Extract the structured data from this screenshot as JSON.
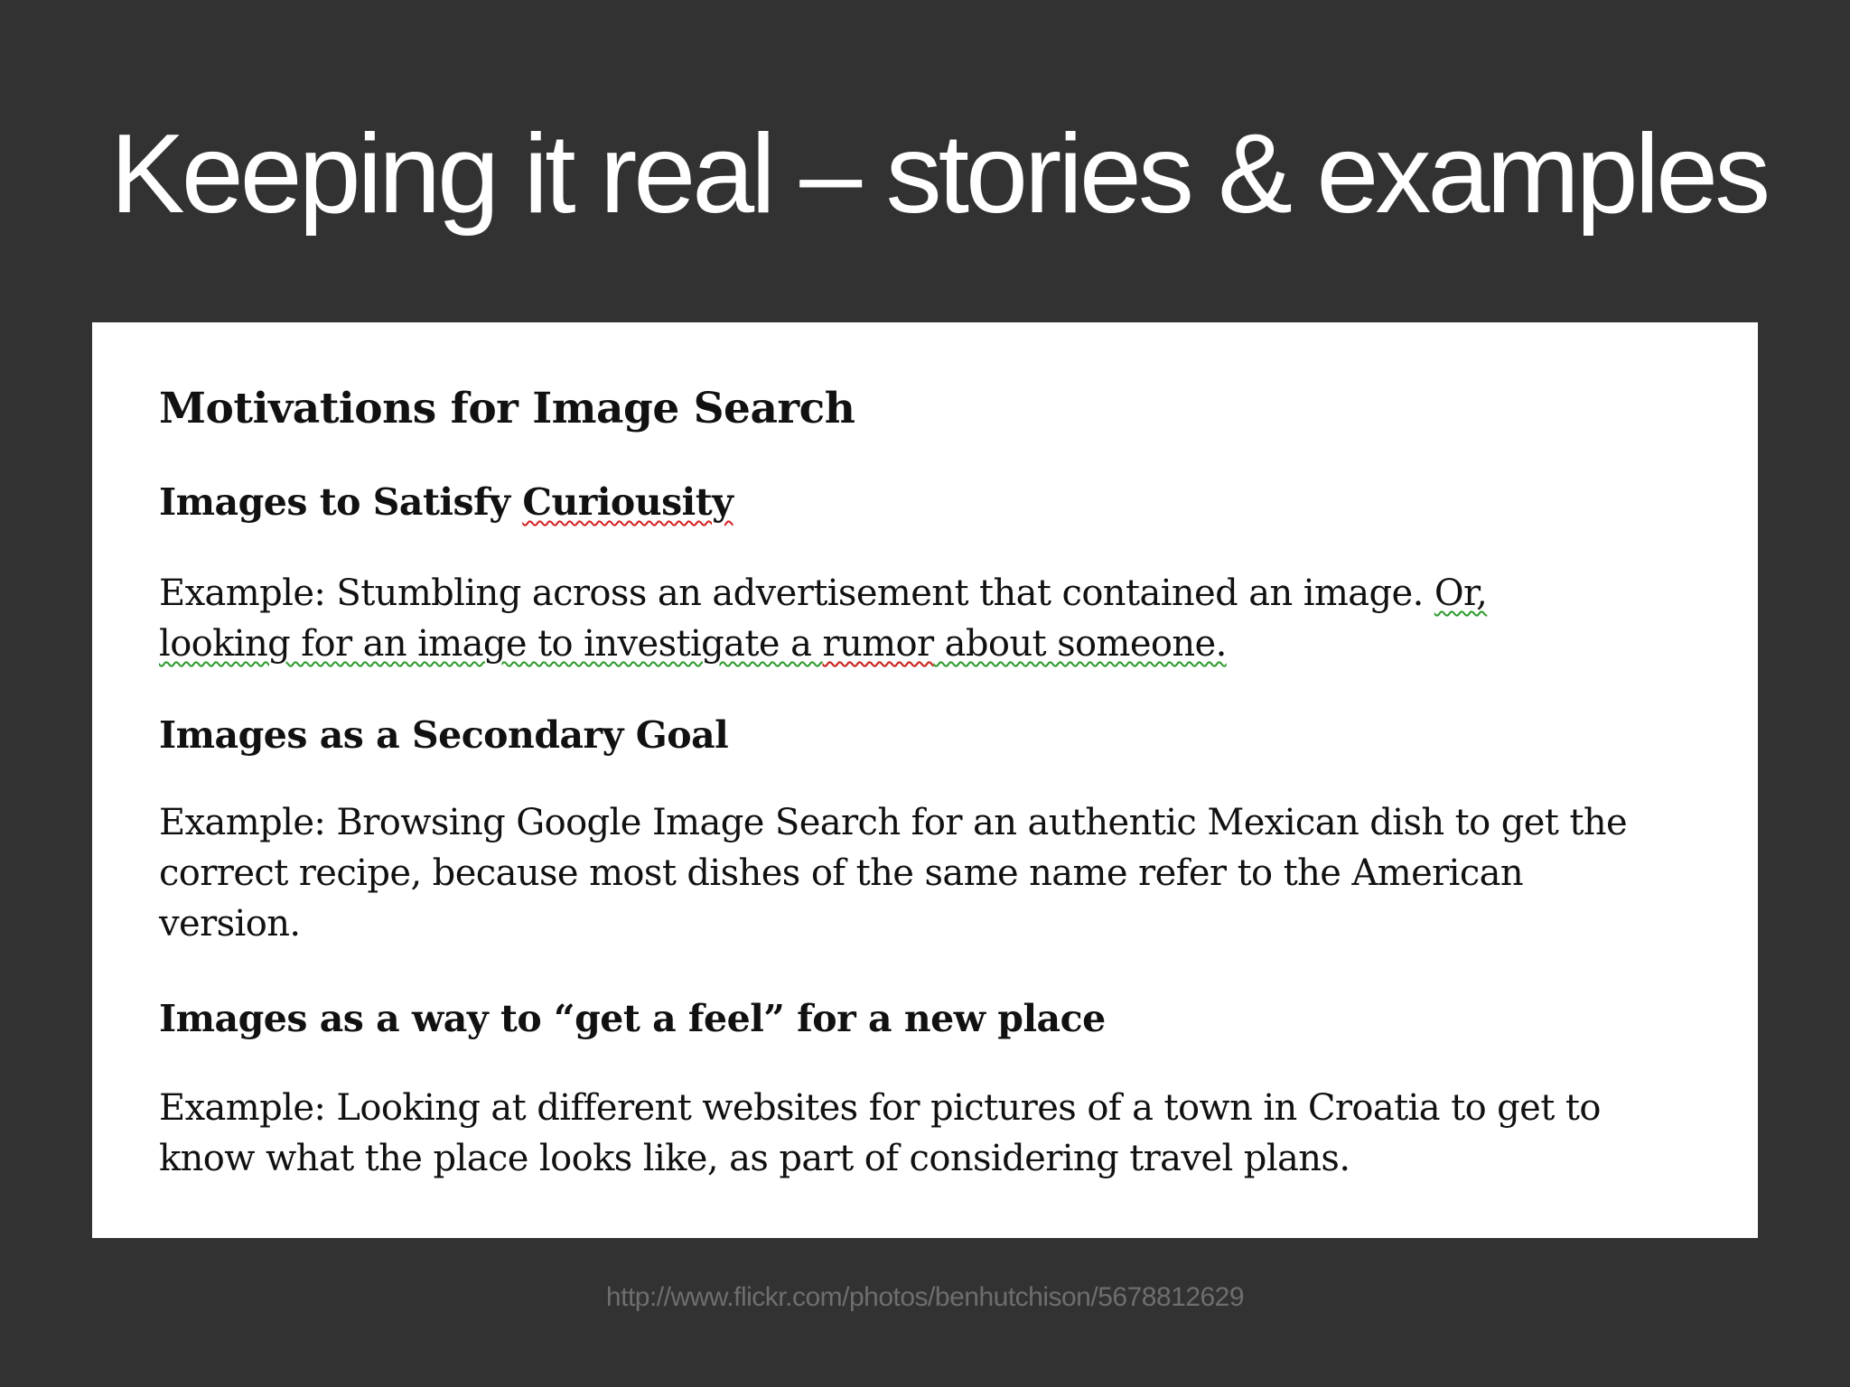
{
  "slide": {
    "title": "Keeping it real – stories & examples",
    "source_url": "http://www.flickr.com/photos/benhutchison/5678812629"
  },
  "document": {
    "title": "Motivations for Image Search",
    "sections": [
      {
        "heading_prefix": "Images to Satisfy ",
        "heading_flagged": "Curiousity",
        "example_line1_text": "Example: Stumbling across an advertisement that contained an image. ",
        "example_line1_flagged": "Or,",
        "example_line2_pre": "looking for an image to investigate a ",
        "example_line2_flagged": "rumor",
        "example_line2_post": " about someone."
      },
      {
        "heading": "Images as a Secondary Goal",
        "example_lines": [
          "Example: Browsing Google Image Search for an authentic Mexican dish to get the",
          "correct recipe, because most dishes of the same name refer to the American",
          "version."
        ]
      },
      {
        "heading": "Images as a way to “get a feel” for a new place",
        "example_lines": [
          "Example: Looking at different websites for pictures of a town in Croatia to get to",
          "know what the place looks like, as part of considering travel plans."
        ]
      }
    ]
  }
}
